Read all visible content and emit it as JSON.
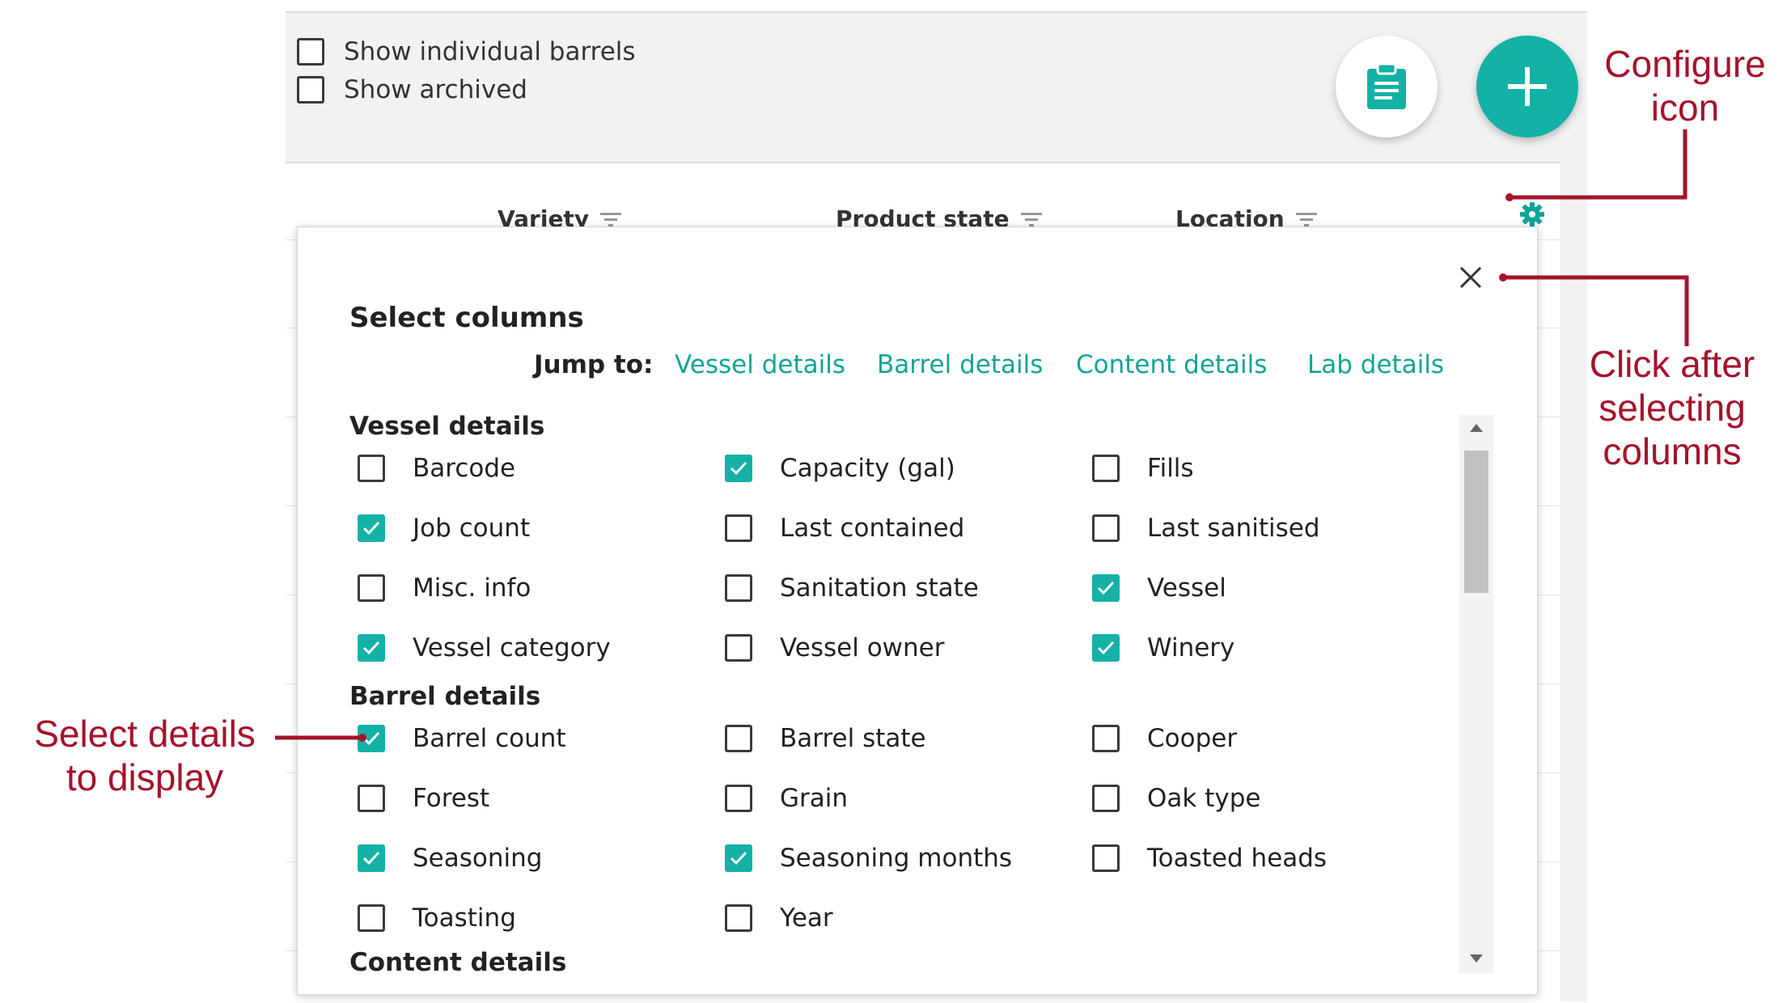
{
  "filters": [
    {
      "label": "Show individual barrels",
      "checked": false
    },
    {
      "label": "Show archived",
      "checked": false
    }
  ],
  "fab": {
    "clipboard_icon": "clipboard-icon",
    "add_icon": "plus-icon"
  },
  "table": {
    "columns": [
      "Variety",
      "Product state",
      "Location"
    ],
    "settings_icon": "gear-icon"
  },
  "dialog": {
    "title": "Select columns",
    "jump_label": "Jump to:",
    "jump_links": [
      "Vessel details",
      "Barrel details",
      "Content details",
      "Lab details"
    ],
    "sections": [
      {
        "title": "Vessel details",
        "options": [
          {
            "label": "Barcode",
            "checked": false
          },
          {
            "label": "Capacity (gal)",
            "checked": true
          },
          {
            "label": "Fills",
            "checked": false
          },
          {
            "label": "Job count",
            "checked": true
          },
          {
            "label": "Last contained",
            "checked": false
          },
          {
            "label": "Last sanitised",
            "checked": false
          },
          {
            "label": "Misc. info",
            "checked": false
          },
          {
            "label": "Sanitation state",
            "checked": false
          },
          {
            "label": "Vessel",
            "checked": true
          },
          {
            "label": "Vessel category",
            "checked": true
          },
          {
            "label": "Vessel owner",
            "checked": false
          },
          {
            "label": "Winery",
            "checked": true
          }
        ]
      },
      {
        "title": "Barrel details",
        "options": [
          {
            "label": "Barrel count",
            "checked": true
          },
          {
            "label": "Barrel state",
            "checked": false
          },
          {
            "label": "Cooper",
            "checked": false
          },
          {
            "label": "Forest",
            "checked": false
          },
          {
            "label": "Grain",
            "checked": false
          },
          {
            "label": "Oak type",
            "checked": false
          },
          {
            "label": "Seasoning",
            "checked": true
          },
          {
            "label": "Seasoning months",
            "checked": true
          },
          {
            "label": "Toasted heads",
            "checked": false
          },
          {
            "label": "Toasting",
            "checked": false
          },
          {
            "label": "Year",
            "checked": false
          }
        ]
      },
      {
        "title": "Content details",
        "options": []
      }
    ]
  },
  "annotations": {
    "configure": [
      "Configure",
      "icon"
    ],
    "click_after": [
      "Click after",
      "selecting",
      "columns"
    ],
    "select_details": [
      "Select details",
      "to display"
    ],
    "color": "#a5132b"
  },
  "colors": {
    "accent": "#14b1a6",
    "link": "#14a398"
  }
}
